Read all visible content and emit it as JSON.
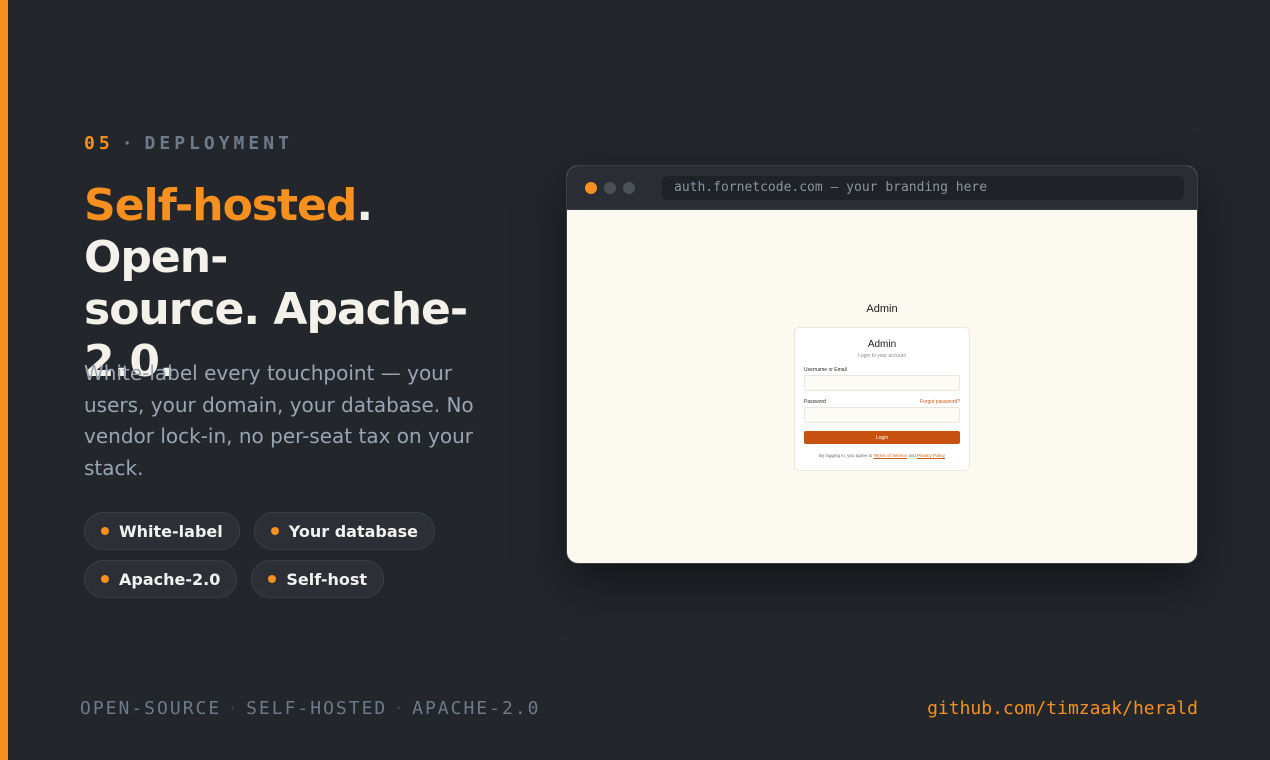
{
  "eyebrow": {
    "number": "05",
    "separator": "·",
    "label": "DEPLOYMENT"
  },
  "headline": {
    "highlight": "Self-hosted",
    "rest_line1": ". Open-",
    "line2": "source. Apache-",
    "line3": "2.0."
  },
  "lede": "White-label every touchpoint — your users, your domain, your database. No vendor lock-in, no per-seat tax on your stack.",
  "chips": {
    "row1": [
      "White-label",
      "Your database"
    ],
    "row2": [
      "Apache-2.0",
      "Self-host"
    ]
  },
  "browser": {
    "url": "auth.fornetcode.com — your branding here",
    "site_title": "Admin",
    "card_title": "Admin",
    "card_subtitle": "Login to your account",
    "username_label": "Username or Email",
    "password_label": "Password",
    "forgot_label": "Forgot password?",
    "login_label": "Login",
    "terms_prefix": "By logging in, you agree to ",
    "terms_link": "Terms of Service",
    "terms_and": " and ",
    "privacy_link": "Privacy Policy"
  },
  "footer": {
    "tags": [
      "OPEN-SOURCE",
      "SELF-HOSTED",
      "APACHE-2.0"
    ],
    "separator": "·",
    "repo": "github.com/timzaak/herald"
  },
  "colors": {
    "accent": "#f7901e",
    "background": "#23272c",
    "button": "#c7520f"
  }
}
